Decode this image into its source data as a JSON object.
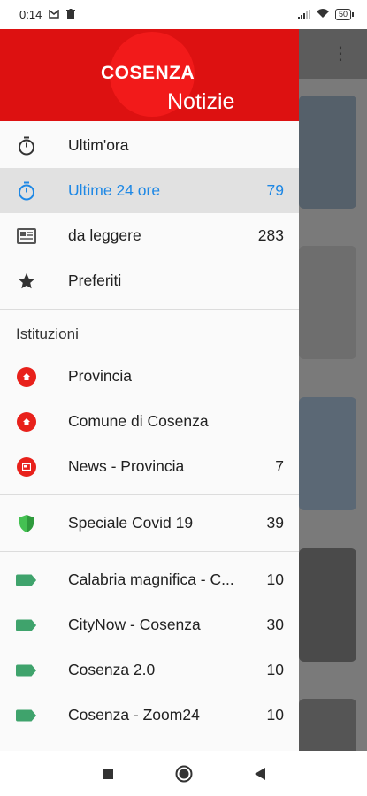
{
  "status": {
    "time": "0:14",
    "battery": "50",
    "icons": [
      "gmail-icon",
      "trash-icon",
      "signal-icon",
      "wifi-icon",
      "battery-icon"
    ]
  },
  "header": {
    "logo_top": "COSENZA",
    "logo_bottom": "Notizie"
  },
  "menu": {
    "main": [
      {
        "label": "Ultim'ora",
        "count": "",
        "icon": "stopwatch-icon"
      },
      {
        "label": "Ultime 24 ore",
        "count": "79",
        "icon": "stopwatch-icon",
        "active": true
      },
      {
        "label": "da leggere",
        "count": "283",
        "icon": "newspaper-icon"
      },
      {
        "label": "Preferiti",
        "count": "",
        "icon": "star-icon"
      }
    ],
    "section_title": "Istituzioni",
    "institutions": [
      {
        "label": "Provincia",
        "count": "",
        "icon": "home-badge-icon"
      },
      {
        "label": "Comune di Cosenza",
        "count": "",
        "icon": "home-badge-icon"
      },
      {
        "label": "News - Provincia",
        "count": "7",
        "icon": "news-badge-icon"
      }
    ],
    "covid": {
      "label": "Speciale Covid 19",
      "count": "39",
      "icon": "shield-icon"
    },
    "sources": [
      {
        "label": "Calabria magnifica - C...",
        "count": "10",
        "icon": "tag-icon"
      },
      {
        "label": "CityNow - Cosenza",
        "count": "30",
        "icon": "tag-icon"
      },
      {
        "label": "Cosenza 2.0",
        "count": "10",
        "icon": "tag-icon"
      },
      {
        "label": "Cosenza - Zoom24",
        "count": "10",
        "icon": "tag-icon"
      }
    ]
  },
  "colors": {
    "brand_red": "#dd1111",
    "active_blue": "#1e88e5",
    "tag_green": "#3fa36c"
  }
}
